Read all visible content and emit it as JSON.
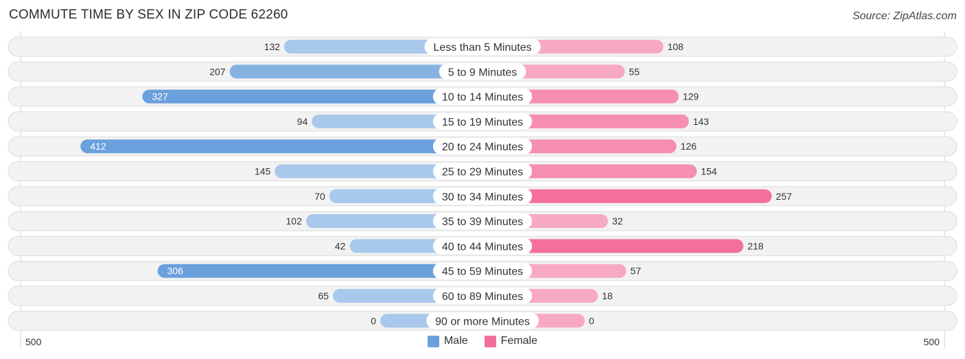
{
  "header": {
    "title": "COMMUTE TIME BY SEX IN ZIP CODE 62260",
    "source": "Source: ZipAtlas.com"
  },
  "colors": {
    "male": "#6aa0dc",
    "male_light": "#a8c8ec",
    "female": "#f4709a",
    "female_light": "#f7a9c2",
    "track": "#f2f2f2",
    "track_border": "#dcdcdc"
  },
  "chart_data": {
    "type": "bar",
    "orientation": "horizontal-diverging",
    "title": "COMMUTE TIME BY SEX IN ZIP CODE 62260",
    "categories": [
      "Less than 5 Minutes",
      "5 to 9 Minutes",
      "10 to 14 Minutes",
      "15 to 19 Minutes",
      "20 to 24 Minutes",
      "25 to 29 Minutes",
      "30 to 34 Minutes",
      "35 to 39 Minutes",
      "40 to 44 Minutes",
      "45 to 59 Minutes",
      "60 to 89 Minutes",
      "90 or more Minutes"
    ],
    "series": [
      {
        "name": "Male",
        "side": "left",
        "values": [
          132,
          207,
          327,
          94,
          412,
          145,
          70,
          102,
          42,
          306,
          65,
          0
        ]
      },
      {
        "name": "Female",
        "side": "right",
        "values": [
          108,
          55,
          129,
          143,
          126,
          154,
          257,
          32,
          218,
          57,
          18,
          0
        ]
      }
    ],
    "axis": {
      "left_tick": "500",
      "right_tick": "500",
      "range": [
        0,
        500
      ]
    },
    "legend": {
      "placement": "bottom-center",
      "entries": [
        "Male",
        "Female"
      ]
    }
  }
}
